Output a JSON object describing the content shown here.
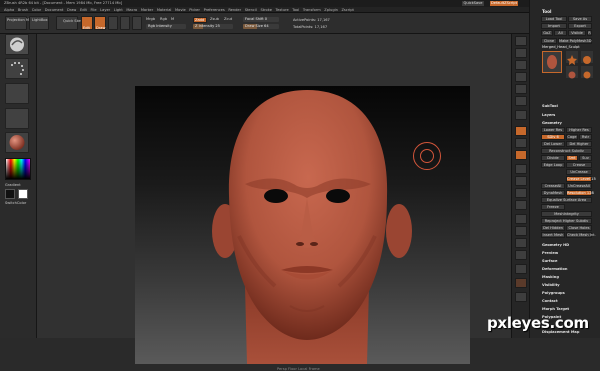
{
  "titlebar": {
    "title": "ZBrush 4R2b 64 bit - [Document - Mem 1984 Mb, Free 27714 Mb]",
    "quicksave": "QuickSave",
    "default_script": "DefaultZScript"
  },
  "menu": [
    "Alpha",
    "Brush",
    "Color",
    "Document",
    "Draw",
    "Edit",
    "File",
    "Layer",
    "Light",
    "Macro",
    "Marker",
    "Material",
    "Movie",
    "Picker",
    "Preferences",
    "Render",
    "Stencil",
    "Stroke",
    "Texture",
    "Tool",
    "Transform",
    "Zplugin",
    "Zscript"
  ],
  "toolbar": {
    "projection_master": "Projection Master",
    "lightbox": "LightBox",
    "quick_sketch": "Quick Sketch",
    "edit": "Edit",
    "draw": "Draw",
    "move": "Move",
    "scale": "Scale",
    "rotate": "Rotate",
    "mrgb": "Mrgb",
    "rgb": "Rgb",
    "m": "M",
    "zadd": "Zadd",
    "zsub": "Zsub",
    "zcut": "Zcut",
    "rgb_intensity": "Rgb Intensity",
    "z_intensity": "Z Intensity 25",
    "focal_shift": "Focal Shift 0",
    "draw_size": "Draw Size 64",
    "active_points": "ActivePoints: 17,167",
    "total_points": "TotalPoints: 17,167"
  },
  "status": "Persp  Floor  Local  Frame",
  "tool_panel": {
    "header": "Tool",
    "load_tool": "Load Tool",
    "save_as": "Save As",
    "import": "Import",
    "export": "Export",
    "goz": "GoZ",
    "all": "All",
    "visible": "Visible",
    "r": "R",
    "clone": "Clone",
    "make_polymesh": "Make PolyMesh3D",
    "current_tool": "Merged_Head_Sculpt",
    "subtool": "SubTool",
    "layers": "Layers",
    "geometry": "Geometry",
    "lower_res": "Lower Res",
    "higher_res": "Higher Res",
    "sdiv": "SDiv 6",
    "cage": "Cage",
    "rstr": "Rstr",
    "del_lower": "Del Lower",
    "del_higher": "Del Higher",
    "reconstruct": "Reconstruct Subdiv",
    "divide": "Divide",
    "smt": "Smt",
    "suv": "Suv",
    "edge_loop": "Edge Loop",
    "crease": "Crease",
    "uncrease": "UnCrease",
    "crease_level": "Crease Level 15",
    "crease_all": "CreaseAll",
    "uncrease_all": "UnCreaseAll",
    "dynamesh": "DynaMesh",
    "resolution": "Resolution 128",
    "equalize": "Equalize Surface Area",
    "freeze": "Freeze",
    "mesh_integrity": "MeshIntegrity",
    "reproject": "Reproject Higher Subdiv",
    "del_hidden": "Del Hidden",
    "close_holes": "Close Holes",
    "insert_mesh": "Insert Mesh",
    "check_mesh": "Check Mesh Int.",
    "fix_mesh": "Fix Mesh",
    "geometry_hd": "Geometry HD",
    "preview": "Preview",
    "surface": "Surface",
    "deformation": "Deformation",
    "masking": "Masking",
    "visibility": "Visibility",
    "polygroups": "Polygroups",
    "contact": "Contact",
    "morph_target": "Morph Target",
    "polypaint": "Polypaint",
    "displacement_map": "Displacement Map"
  },
  "left_shelf": {
    "gradient": "Gradient",
    "switch_color": "SwitchColor"
  },
  "watermark": "pxleyes.com",
  "colors": {
    "accent": "#c6682b",
    "skin": "#b85a42",
    "panel": "#262626"
  }
}
